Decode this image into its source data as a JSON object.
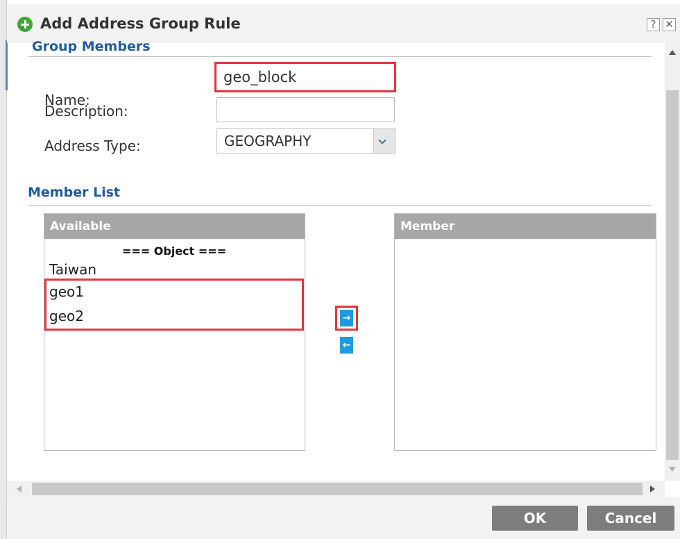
{
  "dialog": {
    "title": "Add Address Group Rule",
    "help_glyph": "?",
    "close_glyph": "✕"
  },
  "group_members": {
    "section_title": "Group Members",
    "name_label": "Name:",
    "name_value": "geo_block",
    "description_label": "Description:",
    "description_value": "",
    "address_type_label": "Address Type:",
    "address_type_value": "GEOGRAPHY"
  },
  "member_list": {
    "section_title": "Member List",
    "available_header": "Available",
    "member_header": "Member",
    "available_group_header": "=== Object ===",
    "available_items": [
      "Taiwan",
      "geo1",
      "geo2"
    ],
    "add_glyph": "→",
    "remove_glyph": "←"
  },
  "footer": {
    "ok_label": "OK",
    "cancel_label": "Cancel"
  },
  "colors": {
    "section_title": "#1f5aa0",
    "highlight": "#e3343c",
    "move_button": "#1e9be0",
    "title_icon": "#3fa535"
  },
  "icons": {
    "title": "add-circle-icon",
    "help": "help-icon",
    "close": "close-icon",
    "dropdown": "chevron-down-icon",
    "add": "arrow-right-icon",
    "remove": "arrow-left-icon"
  }
}
